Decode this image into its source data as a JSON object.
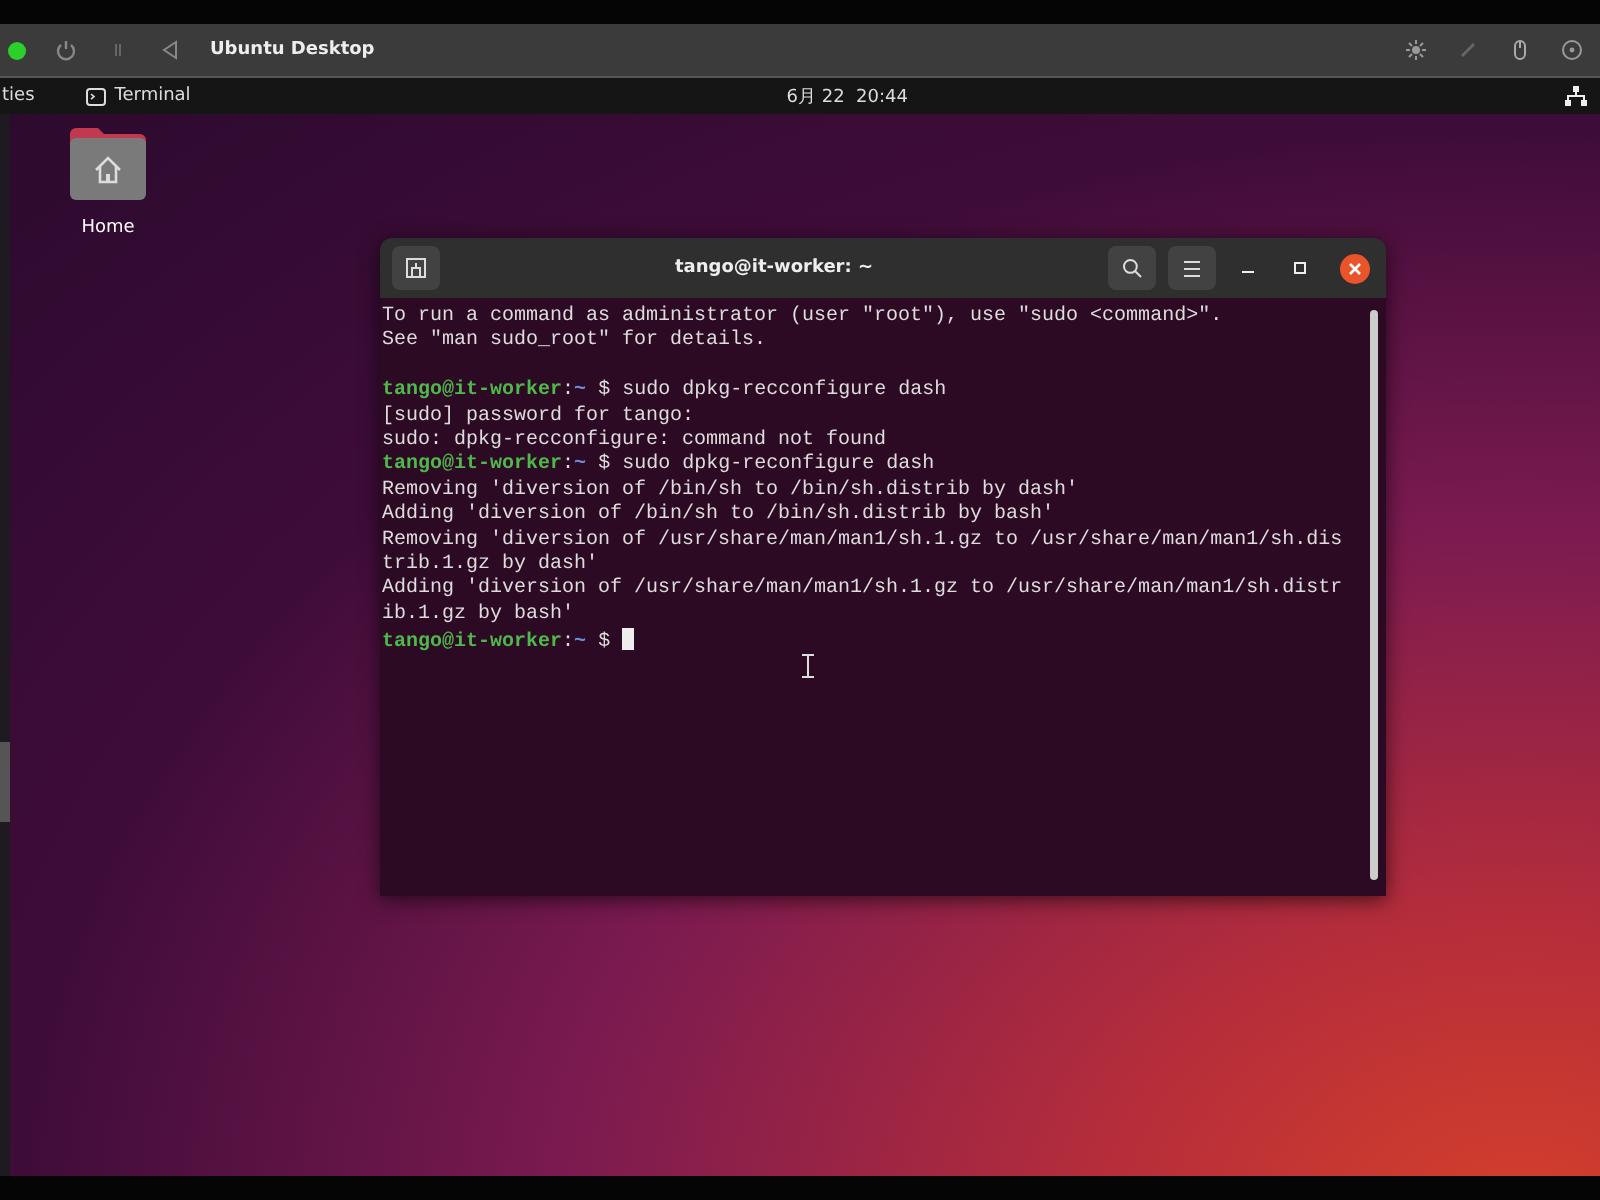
{
  "vm_toolbar": {
    "powered_on": true,
    "title": "Ubuntu Desktop"
  },
  "top_bar": {
    "activities": "ties",
    "app_name": "Terminal",
    "clock": "6月 22  20:44"
  },
  "desktop_icons": [
    {
      "label": "Home"
    }
  ],
  "terminal": {
    "title": "tango@it-worker: ~",
    "lines": [
      {
        "kind": "output",
        "text": "To run a command as administrator (user \"root\"), use \"sudo <command>\"."
      },
      {
        "kind": "output",
        "text": "See \"man sudo_root\" for details."
      },
      {
        "kind": "prompt",
        "gap_before": true,
        "user": "tango@it-worker",
        "sep": ":",
        "path": "~",
        "command": "$ sudo dpkg-recconfigure dash",
        "cursor": false
      },
      {
        "kind": "output",
        "text": "[sudo] password for tango:"
      },
      {
        "kind": "output",
        "text": "sudo: dpkg-recconfigure: command not found"
      },
      {
        "kind": "prompt",
        "gap_before": false,
        "user": "tango@it-worker",
        "sep": ":",
        "path": "~",
        "command": "$ sudo dpkg-reconfigure dash",
        "cursor": false
      },
      {
        "kind": "output",
        "text": "Removing 'diversion of /bin/sh to /bin/sh.distrib by dash'"
      },
      {
        "kind": "output",
        "text": "Adding 'diversion of /bin/sh to /bin/sh.distrib by bash'"
      },
      {
        "kind": "output",
        "text": "Removing 'diversion of /usr/share/man/man1/sh.1.gz to /usr/share/man/man1/sh.dis"
      },
      {
        "kind": "output",
        "text": "trib.1.gz by dash'"
      },
      {
        "kind": "output",
        "text": "Adding 'diversion of /usr/share/man/man1/sh.1.gz to /usr/share/man/man1/sh.distr"
      },
      {
        "kind": "output",
        "text": "ib.1.gz by bash'"
      },
      {
        "kind": "prompt",
        "gap_before": false,
        "user": "tango@it-worker",
        "sep": ":",
        "path": "~",
        "command": "$",
        "cursor": true
      }
    ]
  }
}
